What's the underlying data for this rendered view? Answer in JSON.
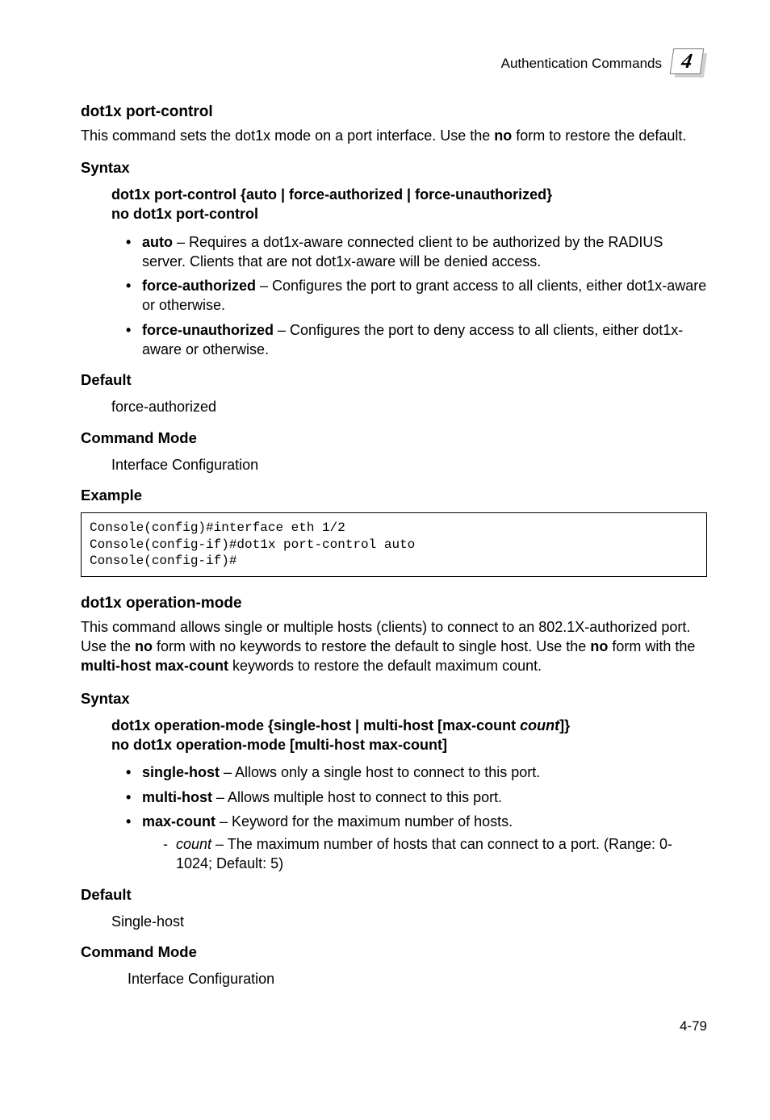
{
  "header": {
    "title": "Authentication Commands",
    "chapter": "4"
  },
  "cmd1": {
    "name": "dot1x port-control",
    "desc_pre": "This command sets the dot1x mode on a port interface. Use the ",
    "desc_bold": "no",
    "desc_post": " form to restore the default.",
    "syntax_label": "Syntax",
    "syntax_l1_pre": "dot1x port-control",
    "syntax_l1_opts": "auto | force-authorized | force-unauthorized",
    "syntax_l2": "no dot1x port-control",
    "b1_label": "auto",
    "b1_text": " – Requires a dot1x-aware connected client to be authorized by the RADIUS server. Clients that are not dot1x-aware will be denied access.",
    "b2_label": "force-authorized",
    "b2_text": " – Configures the port to grant access to all clients, either dot1x-aware or otherwise.",
    "b3_label": "force-unauthorized",
    "b3_text": " – Configures the port to deny access to all clients, either dot1x-aware or otherwise.",
    "default_label": "Default",
    "default_val": "force-authorized",
    "mode_label": "Command Mode",
    "mode_val": "Interface Configuration",
    "example_label": "Example",
    "code": "Console(config)#interface eth 1/2\nConsole(config-if)#dot1x port-control auto\nConsole(config-if)#"
  },
  "cmd2": {
    "name": "dot1x operation-mode",
    "desc_p1": "This command allows single or multiple hosts (clients) to connect to an 802.1X-authorized port. Use the ",
    "desc_b1": "no",
    "desc_p2": " form with no keywords to restore the default to single host. Use the ",
    "desc_b2": "no",
    "desc_p3": " form with the ",
    "desc_b3": "multi-host max-count",
    "desc_p4": " keywords to restore the default maximum count.",
    "syntax_label": "Syntax",
    "syntax_l1_a": "dot1x operation-mode",
    "syntax_l1_b": "single-host",
    "syntax_l1_c": "multi-host",
    "syntax_l1_d": "max-count",
    "syntax_l1_e": "count",
    "syntax_l2": "no dot1x operation-mode",
    "syntax_l2b": "multi-host max-count",
    "b1_label": "single-host",
    "b1_text": " – Allows only a single host to connect to this port.",
    "b2_label": "multi-host",
    "b2_text": " – Allows multiple host to connect to this port.",
    "b3_label": "max-count",
    "b3_text": " – Keyword for the maximum number of hosts.",
    "s1_label": "count",
    "s1_text": " – The maximum number of hosts that can connect to a port. (Range: 0-1024; Default: 5)",
    "default_label": "Default",
    "default_val": "Single-host",
    "mode_label": "Command Mode",
    "mode_val": "Interface Configuration"
  },
  "page_num": "4-79"
}
